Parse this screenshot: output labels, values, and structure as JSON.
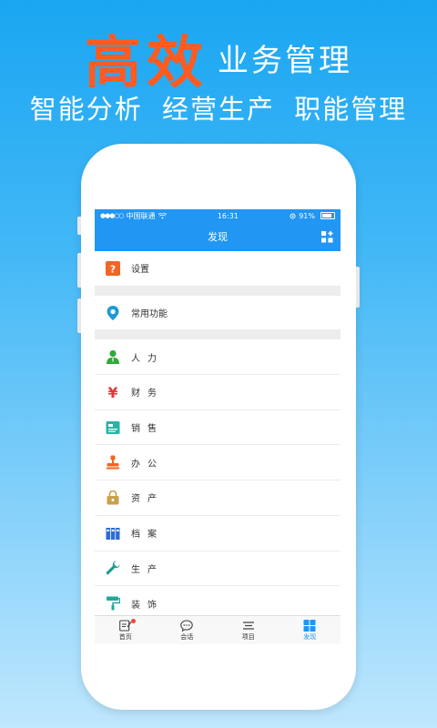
{
  "hero": {
    "title_big": "高效",
    "title_rest": "业务管理",
    "subtitle": "智能分析 经营生产 职能管理"
  },
  "status_bar": {
    "carrier": "中国联通",
    "time": "16:31",
    "battery": "91%"
  },
  "nav": {
    "title": "发现"
  },
  "list": {
    "settings": {
      "label": "设置",
      "icon": "question-icon",
      "color": "#f26522"
    },
    "common": {
      "label": "常用功能",
      "icon": "location-pin-icon",
      "color": "#1e9ad6"
    },
    "items": [
      {
        "label": "人力",
        "icon": "person-icon",
        "color": "#2eaa3b"
      },
      {
        "label": "财务",
        "icon": "yen-icon",
        "color": "#e53935"
      },
      {
        "label": "销售",
        "icon": "sales-card-icon",
        "color": "#26b5a6"
      },
      {
        "label": "办公",
        "icon": "stamp-icon",
        "color": "#f26522"
      },
      {
        "label": "资产",
        "icon": "lock-bag-icon",
        "color": "#c9a14a"
      },
      {
        "label": "档案",
        "icon": "archive-icon",
        "color": "#2d6bd6"
      },
      {
        "label": "生产",
        "icon": "wrench-icon",
        "color": "#1e9a8c"
      },
      {
        "label": "装饰",
        "icon": "paint-roller-icon",
        "color": "#26a69a"
      }
    ]
  },
  "tabbar": {
    "tabs": [
      {
        "label": "首页",
        "icon": "home-edit-icon",
        "badge": true
      },
      {
        "label": "会话",
        "icon": "chat-bubble-icon"
      },
      {
        "label": "项目",
        "icon": "menu-lines-icon"
      },
      {
        "label": "发现",
        "icon": "grid-icon",
        "active": true
      }
    ],
    "active_color": "#2196f3"
  }
}
